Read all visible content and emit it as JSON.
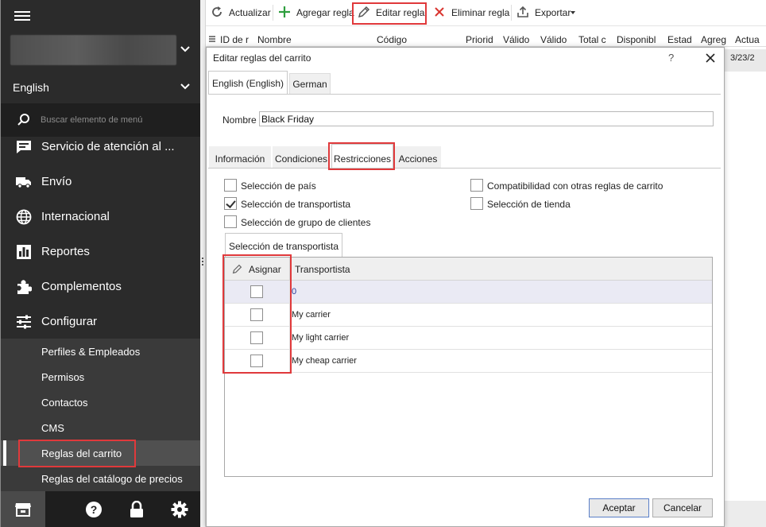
{
  "sidebar": {
    "language": "English",
    "search_placeholder": "Buscar elemento de menú",
    "items": [
      {
        "label": "Servicio de atención al ...",
        "icon": "chat-icon"
      },
      {
        "label": "Envío",
        "icon": "truck-icon"
      },
      {
        "label": "Internacional",
        "icon": "globe-icon"
      },
      {
        "label": "Reportes",
        "icon": "bar-chart-icon"
      },
      {
        "label": "Complementos",
        "icon": "puzzle-icon"
      },
      {
        "label": "Configurar",
        "icon": "sliders-icon"
      }
    ],
    "subitems": [
      "Perfiles & Empleados",
      "Permisos",
      "Contactos",
      "CMS",
      "Reglas del carrito",
      "Reglas del catálogo de precios"
    ],
    "bottom_icons": [
      "store-icon",
      "help-icon",
      "lock-icon",
      "gear-icon"
    ]
  },
  "toolbar": {
    "refresh": "Actualizar",
    "add": "Agregar regla",
    "edit": "Editar regla",
    "delete": "Eliminar regla",
    "export": "Exportar"
  },
  "grid": {
    "columns": [
      "ID de r",
      "Nombre",
      "Código",
      "Priorid",
      "Válido",
      "Válido",
      "Total c",
      "Disponibl",
      "Estad",
      "Agreg",
      "Actua"
    ],
    "row_date": "3/23/2"
  },
  "dialog": {
    "title": "Editar reglas del carrito",
    "help": "?",
    "language_tabs": [
      "English (English)",
      "German"
    ],
    "name_label": "Nombre",
    "name_value": "Black Friday",
    "tabs": [
      "Información",
      "Condiciones",
      "Restricciones",
      "Acciones"
    ],
    "restrictions": {
      "country": "Selección de país",
      "carrier": "Selección de transportista",
      "customer_group": "Selección de grupo de clientes",
      "compatibility": "Compatibilidad con otras reglas de carrito",
      "shop": "Selección de tienda"
    },
    "carrier_tab": "Selección de transportista",
    "carrier_table": {
      "assign_header": "Asignar",
      "carrier_header": "Transportista",
      "rows": [
        "0",
        "My carrier",
        "My light carrier",
        "My cheap carrier"
      ]
    },
    "accept": "Aceptar",
    "cancel": "Cancelar"
  },
  "colors": {
    "sidebar_bg": "#2b2b2b",
    "highlight_red": "#e0393b",
    "add_green": "#2e9e3e",
    "delete_red": "#d9352f"
  }
}
